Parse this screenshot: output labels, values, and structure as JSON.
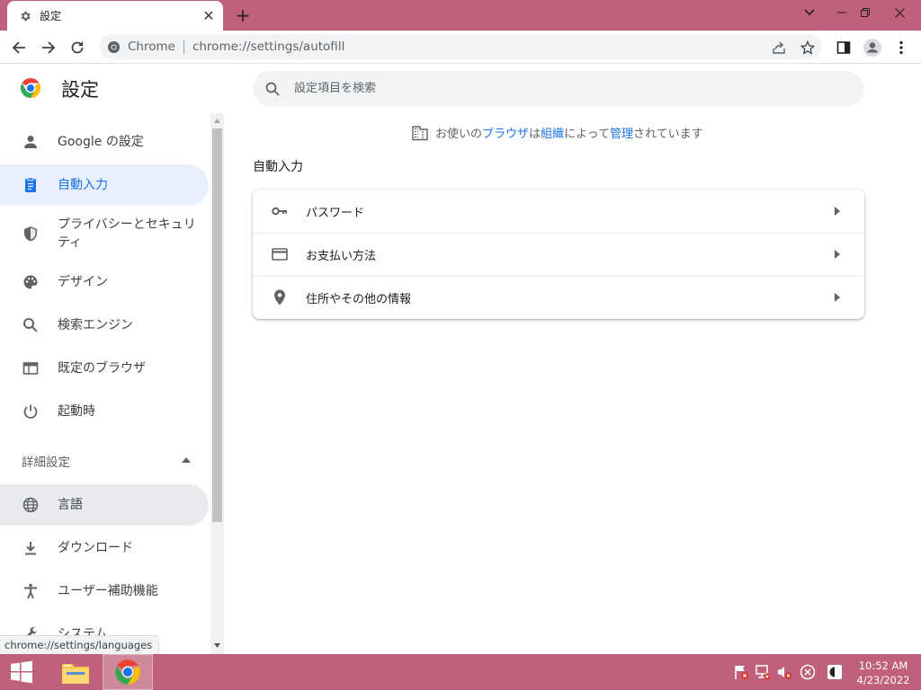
{
  "browser": {
    "tab": {
      "title": "設定",
      "icon": "gear-icon",
      "close": "✕"
    },
    "new_tab": "+",
    "controls": {
      "tab_search": "chevron-down-icon",
      "minimize": "minimize-icon",
      "restore": "restore-icon",
      "close": "close-icon"
    },
    "omnibox": {
      "site_chip": "Chrome",
      "url": "chrome://settings/autofill"
    }
  },
  "settings": {
    "title": "設定",
    "search_placeholder": "設定項目を検索"
  },
  "sidebar": {
    "items": [
      {
        "label": "Google の設定",
        "icon": "person-icon"
      },
      {
        "label": "自動入力",
        "icon": "clipboard-icon",
        "active": true
      },
      {
        "label": "プライバシーとセキュリティ",
        "icon": "shield-icon"
      },
      {
        "label": "デザイン",
        "icon": "palette-icon"
      },
      {
        "label": "検索エンジン",
        "icon": "search-icon"
      },
      {
        "label": "既定のブラウザ",
        "icon": "browser-icon"
      },
      {
        "label": "起動時",
        "icon": "power-icon"
      }
    ],
    "advanced_label": "詳細設定",
    "advanced_items": [
      {
        "label": "言語",
        "icon": "globe-icon"
      },
      {
        "label": "ダウンロード",
        "icon": "download-icon"
      },
      {
        "label": "ユーザー補助機能",
        "icon": "accessibility-icon"
      },
      {
        "label": "システム",
        "icon": "wrench-icon"
      }
    ]
  },
  "main": {
    "managed": {
      "prefix": "お使いの",
      "link1": "ブラウザ",
      "mid1": "は",
      "link2": "組織",
      "mid2": "によって",
      "link3": "管理",
      "suffix": "されています"
    },
    "section_title": "自動入力",
    "rows": [
      {
        "label": "パスワード",
        "icon": "key-icon"
      },
      {
        "label": "お支払い方法",
        "icon": "credit-card-icon"
      },
      {
        "label": "住所やその他の情報",
        "icon": "location-pin-icon"
      }
    ]
  },
  "status_url": "chrome://settings/languages",
  "taskbar": {
    "clock_time": "10:52 AM",
    "clock_date": "4/23/2022"
  },
  "colors": {
    "accent": "#1a73e8",
    "titlebar": "#c0607a",
    "active_bg": "#e8f0fe"
  }
}
